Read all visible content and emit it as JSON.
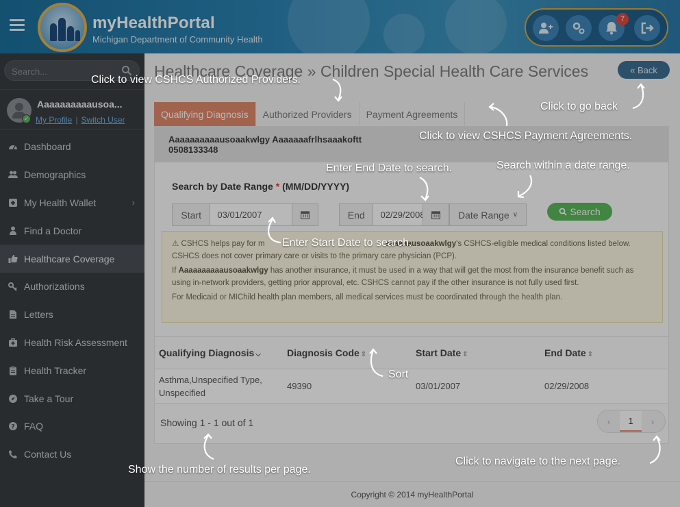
{
  "header": {
    "brand_title": "myHealthPortal",
    "brand_subtitle": "Michigan Department of Community Health",
    "notification_count": "7",
    "icons": [
      "menu-icon",
      "add-user-icon",
      "settings-icon",
      "bell-icon",
      "logout-icon"
    ],
    "colors": {
      "header_bg": "#2f86b6",
      "accent_ring": "#d9a83e",
      "badge": "#e5473c"
    }
  },
  "sidebar": {
    "search_placeholder": "Search...",
    "user_name": "Aaaaaaaaaausoa...",
    "my_profile": "My Profile",
    "separator": "|",
    "switch_user": "Switch User",
    "items": [
      {
        "label": "Dashboard",
        "icon": "dashboard-icon"
      },
      {
        "label": "Demographics",
        "icon": "users-icon"
      },
      {
        "label": "My Health Wallet",
        "icon": "plus-square-icon",
        "has_submenu": true
      },
      {
        "label": "Find a Doctor",
        "icon": "doctor-icon"
      },
      {
        "label": "Healthcare Coverage",
        "icon": "thumbs-up-icon",
        "active": true
      },
      {
        "label": "Authorizations",
        "icon": "key-icon"
      },
      {
        "label": "Letters",
        "icon": "document-icon"
      },
      {
        "label": "Health Risk Assessment",
        "icon": "medkit-icon"
      },
      {
        "label": "Health Tracker",
        "icon": "clipboard-icon"
      },
      {
        "label": "Take a Tour",
        "icon": "compass-icon"
      },
      {
        "label": "FAQ",
        "icon": "question-icon"
      },
      {
        "label": "Contact Us",
        "icon": "phone-icon"
      }
    ]
  },
  "main": {
    "title": "Healthcare Coverage » Children Special Health Care Services",
    "back_label": "« Back",
    "tabs": [
      {
        "label": "Qualifying Diagnosis",
        "active": true
      },
      {
        "label": "Authorized Providers",
        "active": false
      },
      {
        "label": "Payment Agreements",
        "active": false
      }
    ],
    "patient_name": "Aaaaaaaaaausoaakwlgy Aaaaaaafrlhsaaakoftt",
    "patient_id": "0508133348",
    "search": {
      "label": "Search by Date Range",
      "required_mark": "*",
      "format": "(MM/DD/YYYY)",
      "start_label": "Start",
      "start_value": "03/01/2007",
      "end_label": "End",
      "end_value": "02/29/2008",
      "date_range_label": "Date Range",
      "search_label": "Search"
    },
    "notice": {
      "p1_a": "CSHCS helps pay for m",
      "p1_name": "aaaaaausoaakwlgy",
      "p1_b": "'s CSHCS-eligible medical conditions listed below. CSHCS does not cover primary care or visits to the primary care physician (PCP).",
      "p2_a": "If ",
      "p2_name": "Aaaaaaaaaausoaakwlgy",
      "p2_b": " has another insurance, it must be used in a way that will get the most from the insurance benefit such as using in-network providers, getting prior approval, etc. CSHCS cannot pay if the other insurance is not fully used first.",
      "p3": "For Medicaid or MIChild health plan members, all medical services must be coordinated through the health plan."
    },
    "table": {
      "columns": [
        "Qualifying Diagnosis",
        "Diagnosis Code",
        "Start Date",
        "End Date"
      ],
      "rows": [
        {
          "diagnosis": "Asthma,Unspecified Type, Unspecified",
          "code": "49390",
          "start": "03/01/2007",
          "end": "02/29/2008"
        }
      ]
    },
    "showing": "Showing 1 - 1 out of 1",
    "pagination": {
      "current_page": "1",
      "prev": "‹",
      "next": "›"
    },
    "footer": "Copyright © 2014 myHealthPortal"
  },
  "tutorial": {
    "providers": "Click to view CSHCS Authorized Providers.",
    "go_back": "Click to go back",
    "payment": "Click to view CSHCS Payment Agreements.",
    "end_date": "Enter End Date to search.",
    "date_range": "Search within a date range.",
    "start_date": "Enter Start Date to search.",
    "sort": "Sort",
    "results": "Show the number of results per page.",
    "next_page": "Click to navigate to the next page."
  }
}
